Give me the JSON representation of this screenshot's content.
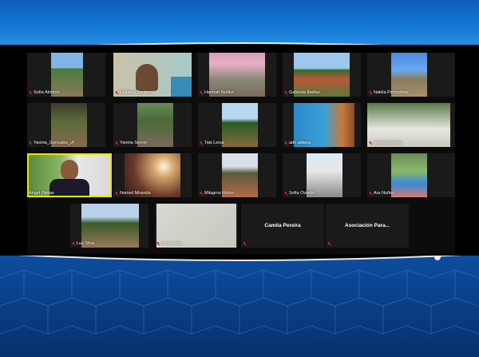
{
  "colors": {
    "accent_blue": "#1478d4",
    "active_speaker_border": "#e6e600",
    "muted_icon": "#e02020",
    "tile_bg": "#1a1a1a"
  },
  "participants": [
    {
      "name": "Sofía Almirón",
      "muted": true
    },
    {
      "name": "Epifania Benitez",
      "muted": true
    },
    {
      "name": "Hannah Nuñez",
      "muted": true
    },
    {
      "name": "Gabriela Ibañez",
      "muted": true
    },
    {
      "name": "Nabila Perruchino",
      "muted": true
    },
    {
      "name": "Yanina_Gonzalez_vf",
      "muted": true
    },
    {
      "name": "Yanina Servin",
      "muted": true
    },
    {
      "name": "Tais Leiva",
      "muted": true
    },
    {
      "name": "adri aldana",
      "muted": true
    },
    {
      "name": "Valeria Benitez",
      "muted": true
    },
    {
      "name": "Ángel Fleitas",
      "muted": false,
      "active_speaker": true
    },
    {
      "name": "Norisel Miranda",
      "muted": true
    },
    {
      "name": "Milagros Rolon",
      "muted": true
    },
    {
      "name": "Sofia Oviedo",
      "muted": true
    },
    {
      "name": "Ara Nuñez",
      "muted": true
    },
    {
      "name": "Luz Silva",
      "muted": true
    },
    {
      "name": "Loren Jara",
      "muted": true
    },
    {
      "name": "Camila Pereira",
      "muted": true,
      "video_off": true
    },
    {
      "name": "Asociación Para...",
      "muted": true,
      "video_off": true
    }
  ]
}
